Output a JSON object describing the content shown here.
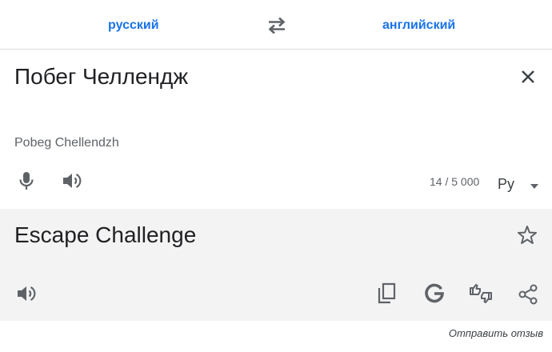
{
  "language_bar": {
    "source_language": "русский",
    "target_language": "английский",
    "swap_icon": "swap-arrows-icon"
  },
  "source": {
    "text": "Побег Челлендж",
    "transliteration": "Pobeg Chellendzh",
    "char_count": "14 / 5 000",
    "keyboard_label": "Py",
    "icons": [
      "close-icon",
      "microphone-icon",
      "speaker-icon",
      "chevron-down-icon"
    ]
  },
  "target": {
    "text": "Escape Challenge",
    "icons": [
      "star-icon",
      "speaker-icon",
      "copy-icon",
      "google-icon",
      "feedback-icon",
      "share-icon"
    ]
  },
  "footer": {
    "send_feedback": "Отправить отзыв"
  },
  "colors": {
    "accent": "#1a73e8",
    "icon": "#5f6368",
    "target_background": "#f3f3f3",
    "divider": "#dadce0"
  }
}
